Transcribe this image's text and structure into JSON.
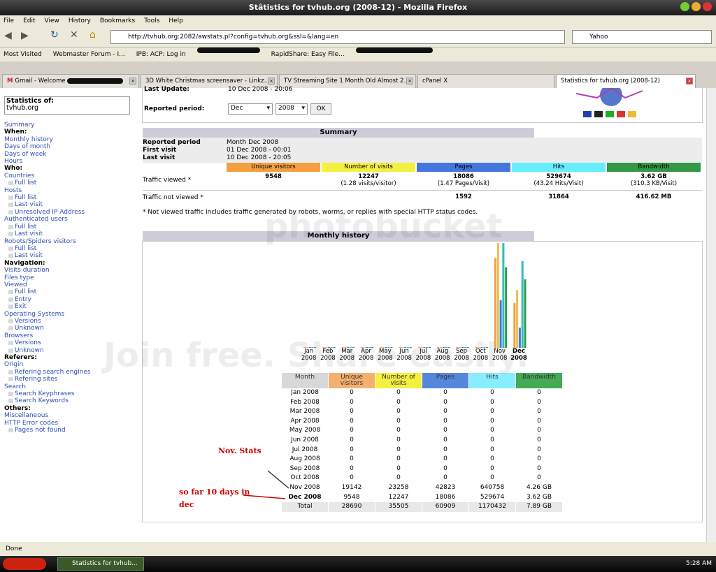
{
  "window": {
    "title": "Stâtistics for tvhub.org (2008-12) - Mozilla Firefox"
  },
  "menu": [
    "File",
    "Edit",
    "View",
    "History",
    "Bookmarks",
    "Tools",
    "Help"
  ],
  "nav": {
    "url": "http://tvhub.org:2082/awstats.pl?config=tvhub.org&ssl=&lang=en",
    "search_placeholder": "Yahoo"
  },
  "bookmarks": [
    "Most Visited",
    "Webmaster Forum - I...",
    "IPB: ACP: Log in",
    "RapidShare: Easy File..."
  ],
  "tabs": [
    "Gmail - Welcome",
    "3D White Christmas screensaver - Linkz...",
    "TV Streaming Site 1 Month Old Almost 2...",
    "cPanel X",
    "Statistics for tvhub.org (2008-12)"
  ],
  "sidebar": {
    "stats_of_label": "Statistics of:",
    "site": "tvhub.org",
    "items": [
      {
        "t": "Summary",
        "k": "link"
      },
      {
        "t": "When:",
        "k": "head"
      },
      {
        "t": "Monthly history",
        "k": "link"
      },
      {
        "t": "Days of month",
        "k": "link"
      },
      {
        "t": "Days of week",
        "k": "link"
      },
      {
        "t": "Hours",
        "k": "link"
      },
      {
        "t": "Who:",
        "k": "head"
      },
      {
        "t": "Countries",
        "k": "link"
      },
      {
        "t": "Full list",
        "k": "sub"
      },
      {
        "t": "Hosts",
        "k": "link"
      },
      {
        "t": "Full list",
        "k": "sub"
      },
      {
        "t": "Last visit",
        "k": "sub"
      },
      {
        "t": "Unresolved IP Address",
        "k": "sub"
      },
      {
        "t": "Authenticated users",
        "k": "link"
      },
      {
        "t": "Full list",
        "k": "sub"
      },
      {
        "t": "Last visit",
        "k": "sub"
      },
      {
        "t": "Robots/Spiders visitors",
        "k": "link"
      },
      {
        "t": "Full list",
        "k": "sub"
      },
      {
        "t": "Last visit",
        "k": "sub"
      },
      {
        "t": "Navigation:",
        "k": "head"
      },
      {
        "t": "Visits duration",
        "k": "link"
      },
      {
        "t": "Files type",
        "k": "link"
      },
      {
        "t": "Viewed",
        "k": "link"
      },
      {
        "t": "Full list",
        "k": "sub"
      },
      {
        "t": "Entry",
        "k": "sub"
      },
      {
        "t": "Exit",
        "k": "sub"
      },
      {
        "t": "Operating Systems",
        "k": "link"
      },
      {
        "t": "Versions",
        "k": "sub"
      },
      {
        "t": "Unknown",
        "k": "sub"
      },
      {
        "t": "Browsers",
        "k": "link"
      },
      {
        "t": "Versions",
        "k": "sub"
      },
      {
        "t": "Unknown",
        "k": "sub"
      },
      {
        "t": "Referers:",
        "k": "head"
      },
      {
        "t": "Origin",
        "k": "link"
      },
      {
        "t": "Refering search engines",
        "k": "sub"
      },
      {
        "t": "Refering sites",
        "k": "sub"
      },
      {
        "t": "Search",
        "k": "link"
      },
      {
        "t": "Search Keyphrases",
        "k": "sub"
      },
      {
        "t": "Search Keywords",
        "k": "sub"
      },
      {
        "t": "Others:",
        "k": "head"
      },
      {
        "t": "Miscellaneous",
        "k": "link"
      },
      {
        "t": "HTTP Error codes",
        "k": "link"
      },
      {
        "t": "Pages not found",
        "k": "sub"
      }
    ]
  },
  "header": {
    "last_update_label": "Last Update:",
    "last_update": "10 Dec 2008 - 20:06",
    "period_label": "Reported period:",
    "month": "Dec",
    "year": "2008",
    "ok": "OK"
  },
  "summary": {
    "title": "Summary",
    "rows": [
      {
        "label": "Reported period",
        "value": "Month Dec 2008"
      },
      {
        "label": "First visit",
        "value": "01 Dec 2008 - 00:01"
      },
      {
        "label": "Last visit",
        "value": "10 Dec 2008 - 20:05"
      }
    ],
    "cols": [
      "Unique visitors",
      "Number of visits",
      "Pages",
      "Hits",
      "Bandwidth"
    ],
    "col_colors": [
      "#f4a040",
      "#f4f040",
      "#4477dd",
      "#66eeff",
      "#339944"
    ],
    "viewed_label": "Traffic viewed *",
    "viewed": [
      "9548",
      "12247",
      "18086",
      "529674",
      "3.62 GB"
    ],
    "viewed_sub": [
      "",
      "(1.28 visits/visitor)",
      "(1.47 Pages/Visit)",
      "(43.24 Hits/Visit)",
      "(310.3 KB/Visit)"
    ],
    "notviewed_label": "Traffic not viewed *",
    "notviewed": [
      "",
      "",
      "1592",
      "31864",
      "416.62 MB"
    ],
    "footnote": "* Not viewed traffic includes traffic generated by robots, worms, or replies with special HTTP status codes."
  },
  "monthly": {
    "title": "Monthly history",
    "headers": [
      "Month",
      "Unique visitors",
      "Number of visits",
      "Pages",
      "Hits",
      "Bandwidth"
    ],
    "rows": [
      [
        "Jan 2008",
        "0",
        "0",
        "0",
        "0",
        "0"
      ],
      [
        "Feb 2008",
        "0",
        "0",
        "0",
        "0",
        "0"
      ],
      [
        "Mar 2008",
        "0",
        "0",
        "0",
        "0",
        "0"
      ],
      [
        "Apr 2008",
        "0",
        "0",
        "0",
        "0",
        "0"
      ],
      [
        "May 2008",
        "0",
        "0",
        "0",
        "0",
        "0"
      ],
      [
        "Jun 2008",
        "0",
        "0",
        "0",
        "0",
        "0"
      ],
      [
        "Jul 2008",
        "0",
        "0",
        "0",
        "0",
        "0"
      ],
      [
        "Aug 2008",
        "0",
        "0",
        "0",
        "0",
        "0"
      ],
      [
        "Sep 2008",
        "0",
        "0",
        "0",
        "0",
        "0"
      ],
      [
        "Oct 2008",
        "0",
        "0",
        "0",
        "0",
        "0"
      ],
      [
        "Nov 2008",
        "19142",
        "23258",
        "42823",
        "640758",
        "4.26 GB"
      ],
      [
        "Dec 2008",
        "9548",
        "12247",
        "18086",
        "529674",
        "3.62 GB"
      ]
    ],
    "total": [
      "Total",
      "28690",
      "35505",
      "60909",
      "1170432",
      "7.89 GB"
    ]
  },
  "chart_data": {
    "type": "bar",
    "categories": [
      "Jan 2008",
      "Feb 2008",
      "Mar 2008",
      "Apr 2008",
      "May 2008",
      "Jun 2008",
      "Jul 2008",
      "Aug 2008",
      "Sep 2008",
      "Oct 2008",
      "Nov 2008",
      "Dec 2008"
    ],
    "month_labels": [
      "Jan",
      "Feb",
      "Mar",
      "Apr",
      "May",
      "Jun",
      "Jul",
      "Aug",
      "Sep",
      "Oct",
      "Nov",
      "Dec"
    ],
    "year_label": "2008",
    "series": [
      {
        "name": "Unique visitors",
        "color": "#f4a040",
        "values": [
          0,
          0,
          0,
          0,
          0,
          0,
          0,
          0,
          0,
          0,
          19142,
          9548
        ]
      },
      {
        "name": "Number of visits",
        "color": "#e8c050",
        "values": [
          0,
          0,
          0,
          0,
          0,
          0,
          0,
          0,
          0,
          0,
          23258,
          12247
        ]
      },
      {
        "name": "Pages",
        "color": "#4477dd",
        "values": [
          0,
          0,
          0,
          0,
          0,
          0,
          0,
          0,
          0,
          0,
          42823,
          18086
        ]
      },
      {
        "name": "Hits",
        "color": "#33bbbb",
        "values": [
          0,
          0,
          0,
          0,
          0,
          0,
          0,
          0,
          0,
          0,
          640758,
          529674
        ]
      },
      {
        "name": "Bandwidth",
        "color": "#339944",
        "values": [
          0,
          0,
          0,
          0,
          0,
          0,
          0,
          0,
          0,
          0,
          4.26,
          3.62
        ]
      }
    ]
  },
  "annotations": {
    "nov": "Nov. Stats",
    "dec": "so far 10 days in dec"
  },
  "watermark": {
    "top": "photobucket",
    "bottom": "Join free. Share easily."
  },
  "status": "Done",
  "taskbar": {
    "item": "Statistics for tvhub...",
    "clock": "5:28 AM"
  }
}
